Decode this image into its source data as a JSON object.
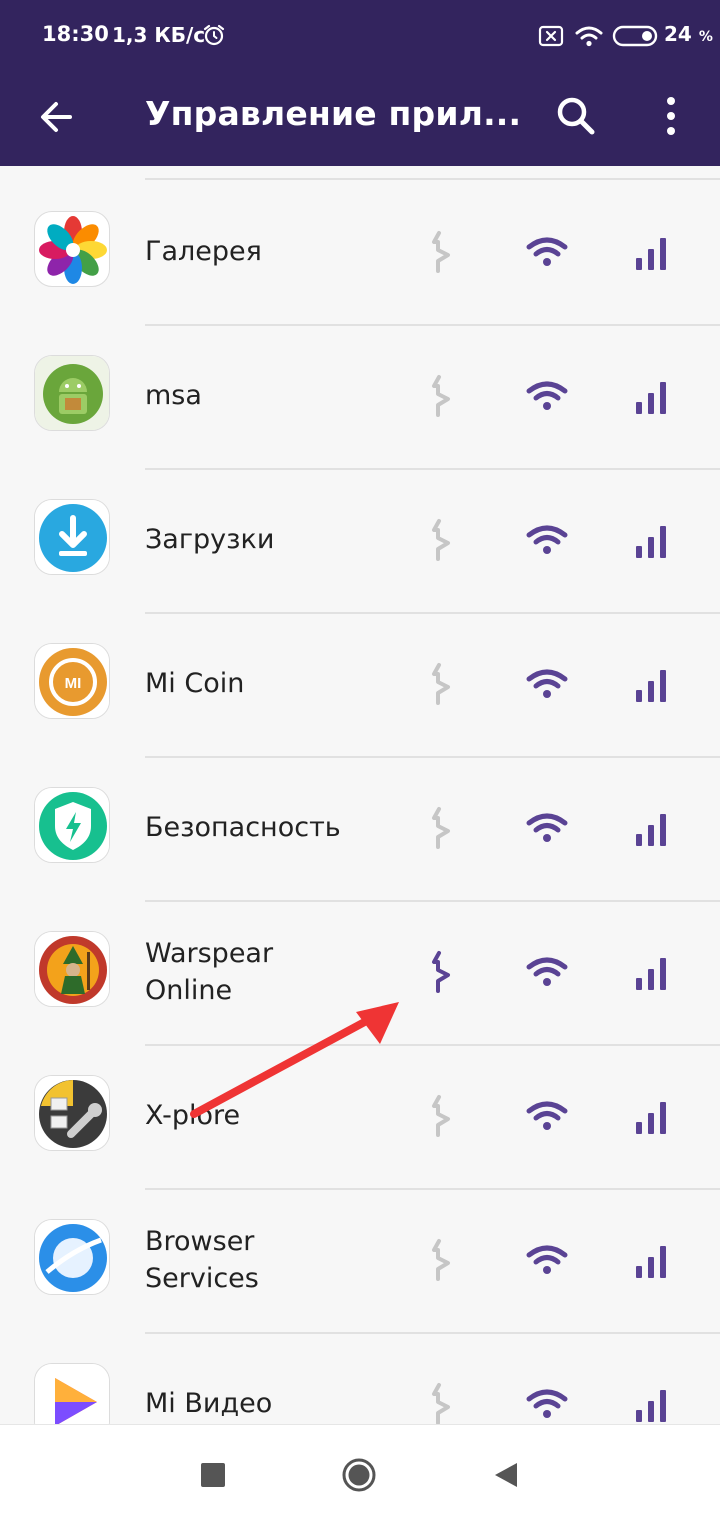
{
  "status_bar": {
    "time": "18:30",
    "speed": "1,3 КБ/с",
    "battery": "24",
    "battery_unit": "%"
  },
  "toolbar": {
    "title": "Управление прил...",
    "icons": [
      "back-arrow-icon",
      "search-icon",
      "more-vert-icon"
    ]
  },
  "apps": [
    {
      "name": "Галерея",
      "icon": "gallery-flower-icon"
    },
    {
      "name": "msa",
      "icon": "android-robot-icon"
    },
    {
      "name": "Загрузки",
      "icon": "download-icon"
    },
    {
      "name": "Mi Coin",
      "icon": "mi-coin-icon"
    },
    {
      "name": "Безопасность",
      "icon": "security-shield-icon"
    },
    {
      "name": "Warspear Online",
      "icon": "warspear-wizard-icon"
    },
    {
      "name": "X-plore",
      "icon": "xplore-wrench-icon"
    },
    {
      "name": "Browser Services",
      "icon": "browser-planet-icon"
    },
    {
      "name": "Mi Видео",
      "icon": "mi-video-play-icon"
    }
  ],
  "colors": {
    "header": "#33245e",
    "accent": "#5a4394",
    "disabled": "#c6c6c6",
    "annotation_arrow": "#ef3434"
  }
}
